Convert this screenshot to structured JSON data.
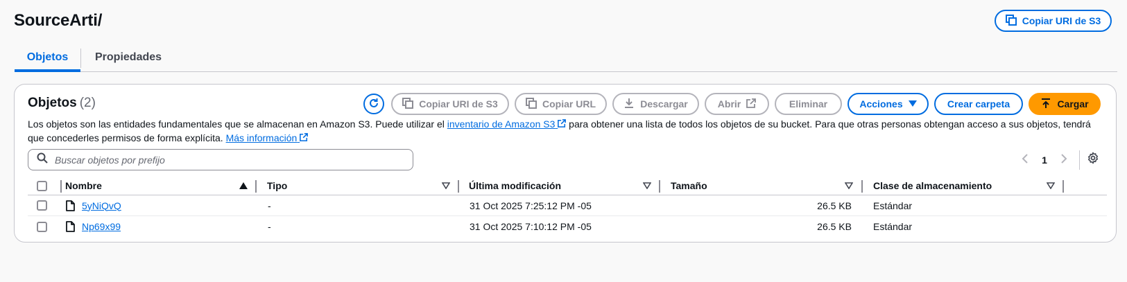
{
  "page": {
    "title": "SourceArti/",
    "copy_s3_uri_label": "Copiar URI de S3"
  },
  "tabs": [
    {
      "label": "Objetos",
      "active": true
    },
    {
      "label": "Propiedades",
      "active": false
    }
  ],
  "objects": {
    "title": "Objetos",
    "count": "(2)",
    "toolbar": {
      "copy_uri": "Copiar URI de S3",
      "copy_url": "Copiar URL",
      "download": "Descargar",
      "open": "Abrir",
      "delete": "Eliminar",
      "actions": "Acciones",
      "create_folder": "Crear carpeta",
      "upload": "Cargar"
    },
    "description": {
      "part1": "Los objetos son las entidades fundamentales que se almacenan en Amazon S3. Puede utilizar el",
      "link1": "inventario de Amazon S3",
      "part2": "para obtener una lista de todos los objetos de su bucket. Para que otras personas obtengan acceso a sus objetos, tendrá que concederles permisos de forma explícita.",
      "link2": "Más información"
    },
    "search_placeholder": "Buscar objetos por prefijo",
    "pagination": {
      "current_page": "1"
    },
    "columns": {
      "name": "Nombre",
      "type": "Tipo",
      "modified": "Última modificación",
      "size": "Tamaño",
      "storage": "Clase de almacenamiento"
    },
    "rows": [
      {
        "name": "5yNiQvQ",
        "type": "-",
        "modified": "31 Oct 2025 7:25:12 PM -05",
        "size": "26.5 KB",
        "storage": "Estándar"
      },
      {
        "name": "Np69x99",
        "type": "-",
        "modified": "31 Oct 2025 7:10:12 PM -05",
        "size": "26.5 KB",
        "storage": "Estándar"
      }
    ]
  },
  "colors": {
    "accent": "#006ce0",
    "primary_button": "#ff9900",
    "disabled": "#8c8c94"
  },
  "icons": [
    "copy-icon",
    "refresh-icon",
    "download-icon",
    "external-link-icon",
    "caret-down-icon",
    "upload-icon",
    "search-icon",
    "chevron-left-icon",
    "chevron-right-icon",
    "settings-icon",
    "sort-ascending-icon",
    "sort-descending-icon",
    "file-icon"
  ]
}
